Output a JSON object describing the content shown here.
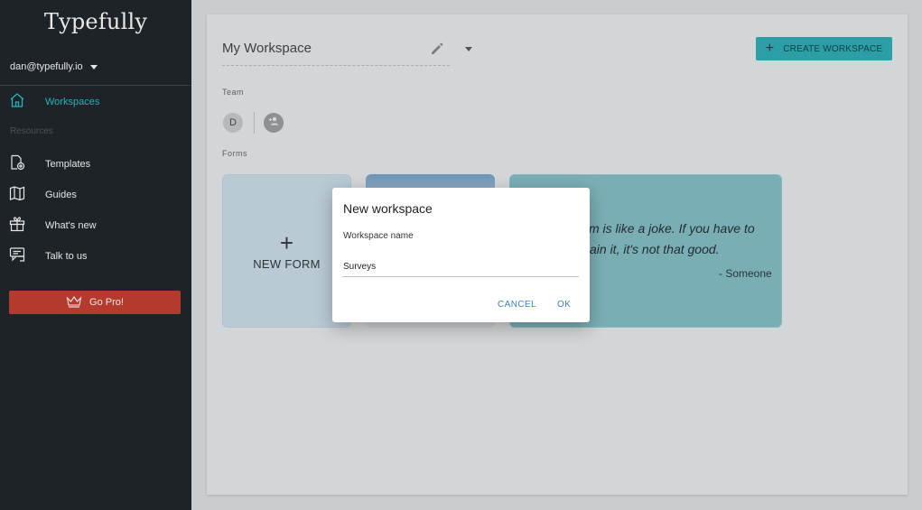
{
  "app": {
    "name": "Typefully"
  },
  "account": {
    "email": "dan@typefully.io"
  },
  "sidebar": {
    "items": [
      {
        "label": "Workspaces",
        "icon": "home-icon",
        "active": true
      },
      {
        "label": "Templates",
        "icon": "file-add-icon"
      },
      {
        "label": "Guides",
        "icon": "book-icon"
      },
      {
        "label": "What's new",
        "icon": "gift-icon"
      },
      {
        "label": "Talk to us",
        "icon": "chat-icon"
      }
    ],
    "resources_label": "Resources",
    "gopro_label": "Go Pro!"
  },
  "workspace": {
    "title": "My Workspace",
    "create_label": "CREATE WORKSPACE",
    "team_label": "Team",
    "member_initial": "D",
    "forms_label": "Forms",
    "new_form_label": "NEW FORM",
    "quote_line1": "m is like a joke. If you have to",
    "quote_line2": "ain it, it's not that good.",
    "quote_author": "- Someone"
  },
  "dialog": {
    "title": "New workspace",
    "field_label": "Workspace name",
    "field_value": "Surveys",
    "cancel_label": "CANCEL",
    "ok_label": "OK"
  },
  "colors": {
    "sidebar_bg": "#1e2327",
    "accent_teal": "#24b3bf",
    "gopro_red": "#b53a2e",
    "dialog_button": "#3d82c4"
  }
}
